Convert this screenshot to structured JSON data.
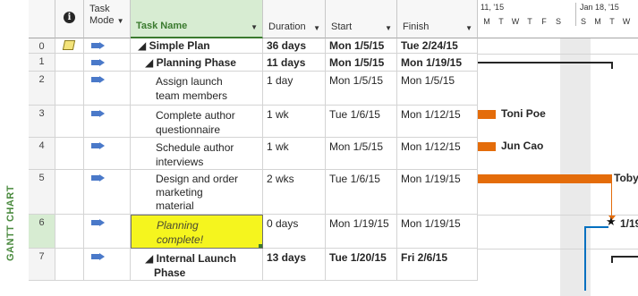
{
  "side_label": "GANTT CHART",
  "columns": {
    "info": "i",
    "task_mode_line1": "Task",
    "task_mode_line2": "Mode",
    "task_name": "Task Name",
    "duration": "Duration",
    "start": "Start",
    "finish": "Finish"
  },
  "timescale": {
    "week1": "11, '15",
    "week2": "Jan 18, '15",
    "days": [
      "M",
      "T",
      "W",
      "T",
      "F",
      "S",
      "S",
      "M",
      "T",
      "W"
    ]
  },
  "rows": [
    {
      "id": "0",
      "name": "◢ Simple Plan",
      "duration": "36 days",
      "start": "Mon 1/5/15",
      "finish": "Tue 2/24/15",
      "has_note": true
    },
    {
      "id": "1",
      "name": "◢ Planning Phase",
      "duration": "11 days",
      "start": "Mon 1/5/15",
      "finish": "Mon 1/19/15"
    },
    {
      "id": "2",
      "name_line1": "Assign launch",
      "name_line2": "team members",
      "duration": "1 day",
      "start": "Mon 1/5/15",
      "finish": "Mon 1/5/15"
    },
    {
      "id": "3",
      "name_line1": "Complete author",
      "name_line2": "questionnaire",
      "duration": "1 wk",
      "start": "Tue 1/6/15",
      "finish": "Mon 1/12/15",
      "resource": "Toni Poe"
    },
    {
      "id": "4",
      "name_line1": "Schedule author",
      "name_line2": "interviews",
      "duration": "1 wk",
      "start": "Mon 1/5/15",
      "finish": "Mon 1/12/15",
      "resource": "Jun Cao"
    },
    {
      "id": "5",
      "name_line1": "Design and order",
      "name_line2": "marketing",
      "name_line3": "material",
      "duration": "2 wks",
      "start": "Tue 1/6/15",
      "finish": "Mon 1/19/15",
      "resource": "Toby"
    },
    {
      "id": "6",
      "name_line1": "Planning",
      "name_line2": "complete!",
      "duration": "0 days",
      "start": "Mon 1/19/15",
      "finish": "Mon 1/19/15",
      "milestone_label": "1/19"
    },
    {
      "id": "7",
      "name_line1": "◢ Internal Launch",
      "name_line2": "Phase",
      "duration": "13 days",
      "start": "Tue 1/20/15",
      "finish": "Fri 2/6/15"
    }
  ],
  "colors": {
    "accent": "#3a7a2e",
    "bar": "#e46c0a",
    "selection": "#f5f51e",
    "callout": "#0070c0"
  }
}
